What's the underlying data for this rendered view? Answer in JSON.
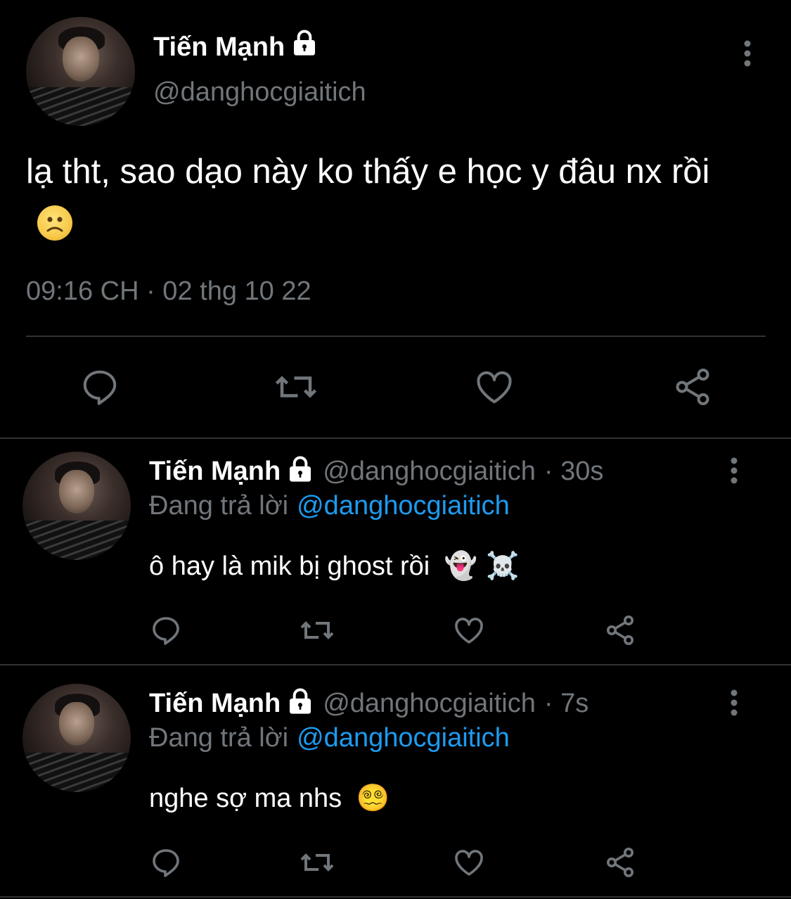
{
  "main_tweet": {
    "display_name": "Tiến Mạnh",
    "handle": "@danghocgiaitich",
    "text": "lạ tht, sao dạo này ko thấy e học y đâu nx rồi",
    "emoji": "🙁",
    "timestamp": "09:16 CH · 02 thg 10 22",
    "icons": {
      "verified_lock": "lock-icon",
      "more": "more-vertical-icon",
      "reply": "reply-icon",
      "retweet": "retweet-icon",
      "like": "heart-icon",
      "share": "share-icon"
    }
  },
  "replies": [
    {
      "display_name": "Tiến Mạnh",
      "handle": "@danghocgiaitich",
      "time": "· 30s",
      "replying_to_label": "Đang trả lời",
      "replying_to_handle": "@danghocgiaitich",
      "text": "ô hay là mik bị ghost rồi",
      "emojis": "👻 ☠️"
    },
    {
      "display_name": "Tiến Mạnh",
      "handle": "@danghocgiaitich",
      "time": "· 7s",
      "replying_to_label": "Đang trả lời",
      "replying_to_handle": "@danghocgiaitich",
      "text": "nghe sợ ma nhs",
      "emojis": "😵‍💫"
    }
  ],
  "colors": {
    "background": "#000000",
    "text_primary": "#ffffff",
    "text_secondary": "#71767b",
    "accent": "#1d9bf0",
    "divider": "#2f3336"
  }
}
